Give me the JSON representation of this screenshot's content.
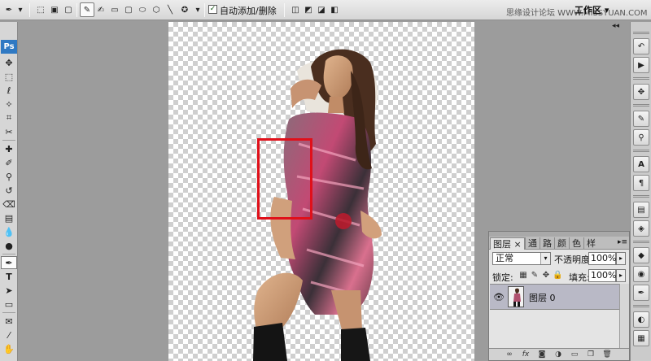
{
  "options_bar": {
    "auto_add_delete_checked": "✓",
    "auto_add_delete_label": "自动添加/删除",
    "workspace_label": "工作区 ▾",
    "watermark": "思缘设计论坛 WWW.MISSYUAN.COM"
  },
  "toolbar": {
    "logo": "Ps",
    "tools": [
      "move",
      "marquee",
      "lasso",
      "magic-wand",
      "crop",
      "slice",
      "healing",
      "brush",
      "clone-stamp",
      "history-brush",
      "eraser",
      "gradient",
      "blur",
      "dodge",
      "pen",
      "type",
      "path-selection",
      "shape",
      "notes",
      "eyedropper"
    ]
  },
  "layers_panel": {
    "tabs": [
      "图层",
      "×",
      "通",
      "路",
      "颜",
      "色",
      "样"
    ],
    "blend_mode": "正常",
    "opacity_label": "不透明度:",
    "opacity_value": "100%",
    "lock_label": "锁定:",
    "fill_label": "填充:",
    "fill_value": "100%",
    "layer_name": "图层 0",
    "bottom_icons": [
      "link",
      "fx",
      "mask",
      "adjustment",
      "group",
      "new-layer",
      "trash"
    ]
  },
  "right_dock": {
    "icons": [
      "history",
      "actions",
      "tool-presets",
      "brushes",
      "clone-source",
      "character",
      "paragraph",
      "layer-comps",
      "navigator",
      "layers",
      "channels",
      "paths",
      "color",
      "swatches"
    ]
  },
  "colors": {
    "selection_highlight": "#e0101a",
    "photoshop_blue": "#2f79c3",
    "layer_selected": "#b9b9c6"
  }
}
